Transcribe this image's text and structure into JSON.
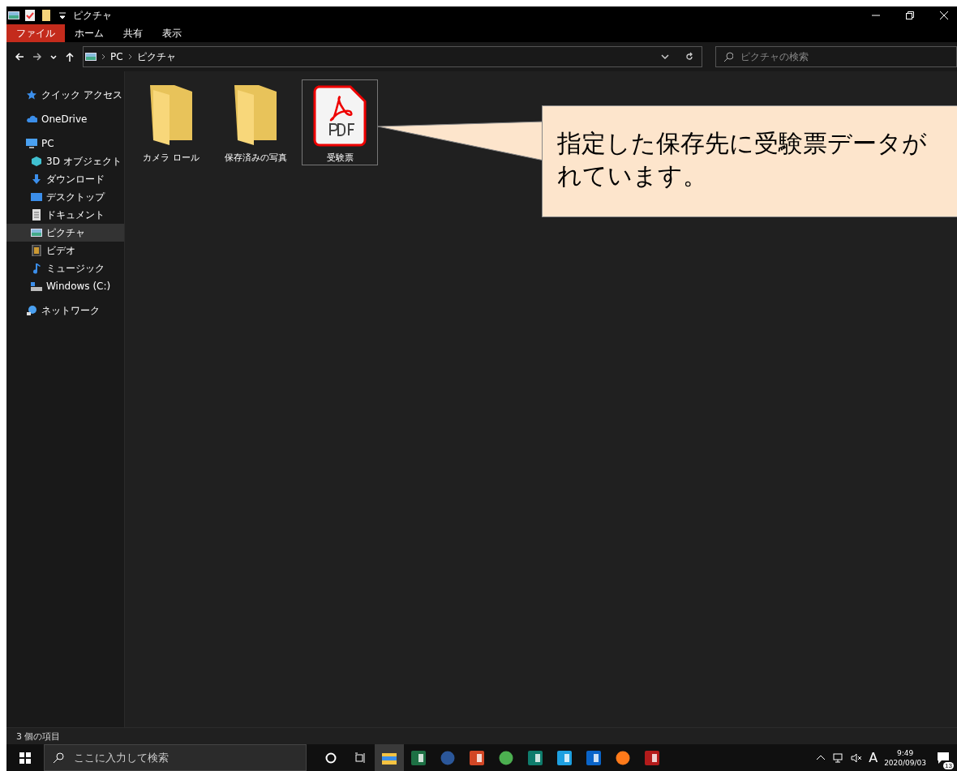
{
  "window": {
    "title": "ピクチャ"
  },
  "ribbon_tabs": [
    {
      "label": "ファイル",
      "selected": true
    },
    {
      "label": "ホーム",
      "selected": false
    },
    {
      "label": "共有",
      "selected": false
    },
    {
      "label": "表示",
      "selected": false
    }
  ],
  "address_bar": {
    "path": [
      "PC",
      "ピクチャ"
    ]
  },
  "search": {
    "placeholder": "ピクチャの検索"
  },
  "sidebar": {
    "items": [
      {
        "label": "クイック アクセス",
        "selected": false
      },
      {
        "label": "OneDrive",
        "selected": false
      },
      {
        "label": "PC",
        "selected": false,
        "children": [
          {
            "label": "3D オブジェクト",
            "selected": false
          },
          {
            "label": "ダウンロード",
            "selected": false
          },
          {
            "label": "デスクトップ",
            "selected": false
          },
          {
            "label": "ドキュメント",
            "selected": false
          },
          {
            "label": "ピクチャ",
            "selected": true
          },
          {
            "label": "ビデオ",
            "selected": false
          },
          {
            "label": "ミュージック",
            "selected": false
          },
          {
            "label": "Windows (C:)",
            "selected": false
          }
        ]
      },
      {
        "label": "ネットワーク",
        "selected": false
      }
    ]
  },
  "files": [
    {
      "name": "カメラ ロール",
      "kind": "folder",
      "selected": false
    },
    {
      "name": "保存済みの写真",
      "kind": "folder",
      "selected": false
    },
    {
      "name": "受験票",
      "kind": "pdf",
      "selected": true
    }
  ],
  "callout": {
    "lines": [
      "指定した保存先に受験票データが",
      "れています。"
    ]
  },
  "status_bar": {
    "count": "3 個の項目"
  },
  "taskbar": {
    "search_placeholder": "ここに入力して検索",
    "pinned": [
      {
        "selected": false
      },
      {
        "selected": false
      },
      {
        "selected": true
      },
      {
        "selected": false
      },
      {
        "selected": false
      },
      {
        "selected": false
      },
      {
        "selected": false
      },
      {
        "selected": false
      },
      {
        "selected": false
      },
      {
        "selected": false
      },
      {
        "selected": false
      },
      {
        "selected": false
      }
    ],
    "ime": "A",
    "time": "9:49",
    "date": "2020/09/03",
    "notifications": "13"
  }
}
